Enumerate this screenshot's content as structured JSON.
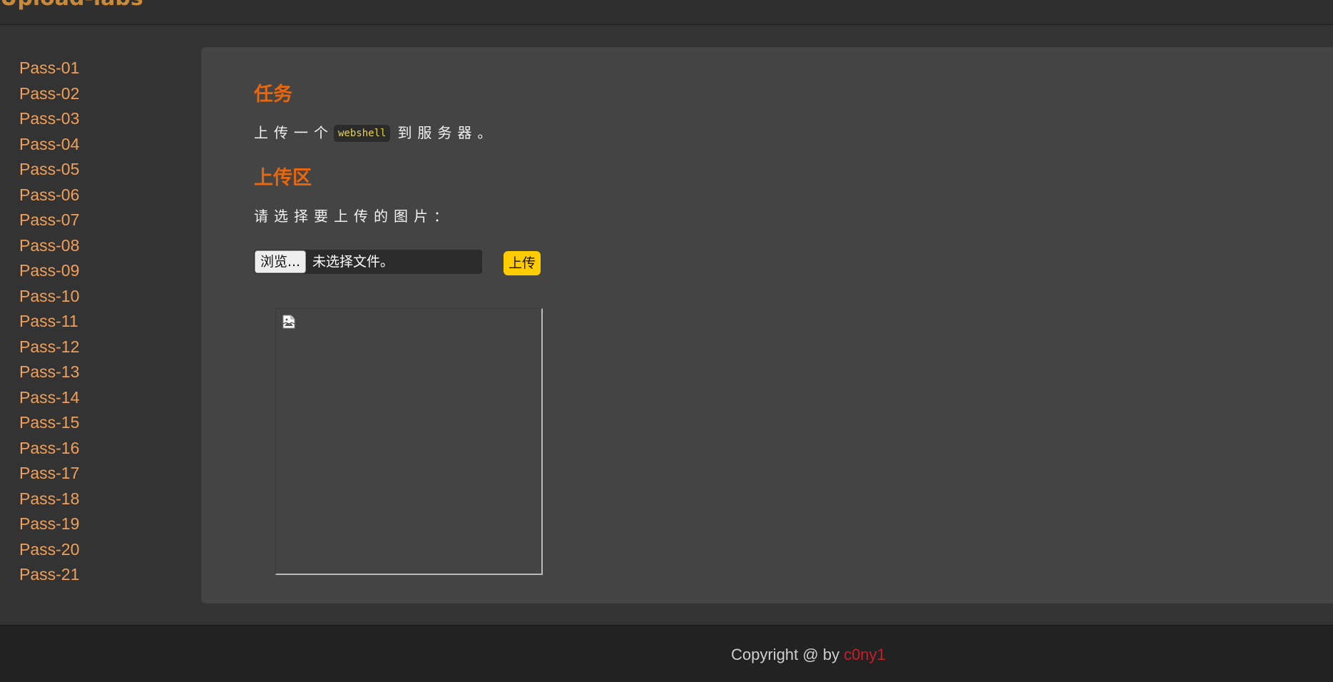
{
  "header": {
    "title": "Upload-labs"
  },
  "sidebar": {
    "items": [
      {
        "label": "Pass-01"
      },
      {
        "label": "Pass-02"
      },
      {
        "label": "Pass-03"
      },
      {
        "label": "Pass-04"
      },
      {
        "label": "Pass-05"
      },
      {
        "label": "Pass-06"
      },
      {
        "label": "Pass-07"
      },
      {
        "label": "Pass-08"
      },
      {
        "label": "Pass-09"
      },
      {
        "label": "Pass-10"
      },
      {
        "label": "Pass-11"
      },
      {
        "label": "Pass-12"
      },
      {
        "label": "Pass-13"
      },
      {
        "label": "Pass-14"
      },
      {
        "label": "Pass-15"
      },
      {
        "label": "Pass-16"
      },
      {
        "label": "Pass-17"
      },
      {
        "label": "Pass-18"
      },
      {
        "label": "Pass-19"
      },
      {
        "label": "Pass-20"
      },
      {
        "label": "Pass-21"
      }
    ]
  },
  "main": {
    "task_heading": "任务",
    "task_desc_before": "上传一个",
    "task_code": "webshell",
    "task_desc_after": "到服务器。",
    "upload_heading": "上传区",
    "upload_prompt": "请选择要上传的图片：",
    "browse_label": "浏览...",
    "file_status": "未选择文件。",
    "upload_button": "上传"
  },
  "footer": {
    "copyright": "Copyright @  by ",
    "author": "c0ny1"
  },
  "colors": {
    "accent_orange": "#e8670c",
    "link_orange": "#f0a05a",
    "upload_yellow": "#ffcc00",
    "author_red": "#c81e2a"
  },
  "icons": {
    "preview": "broken-image-icon"
  }
}
